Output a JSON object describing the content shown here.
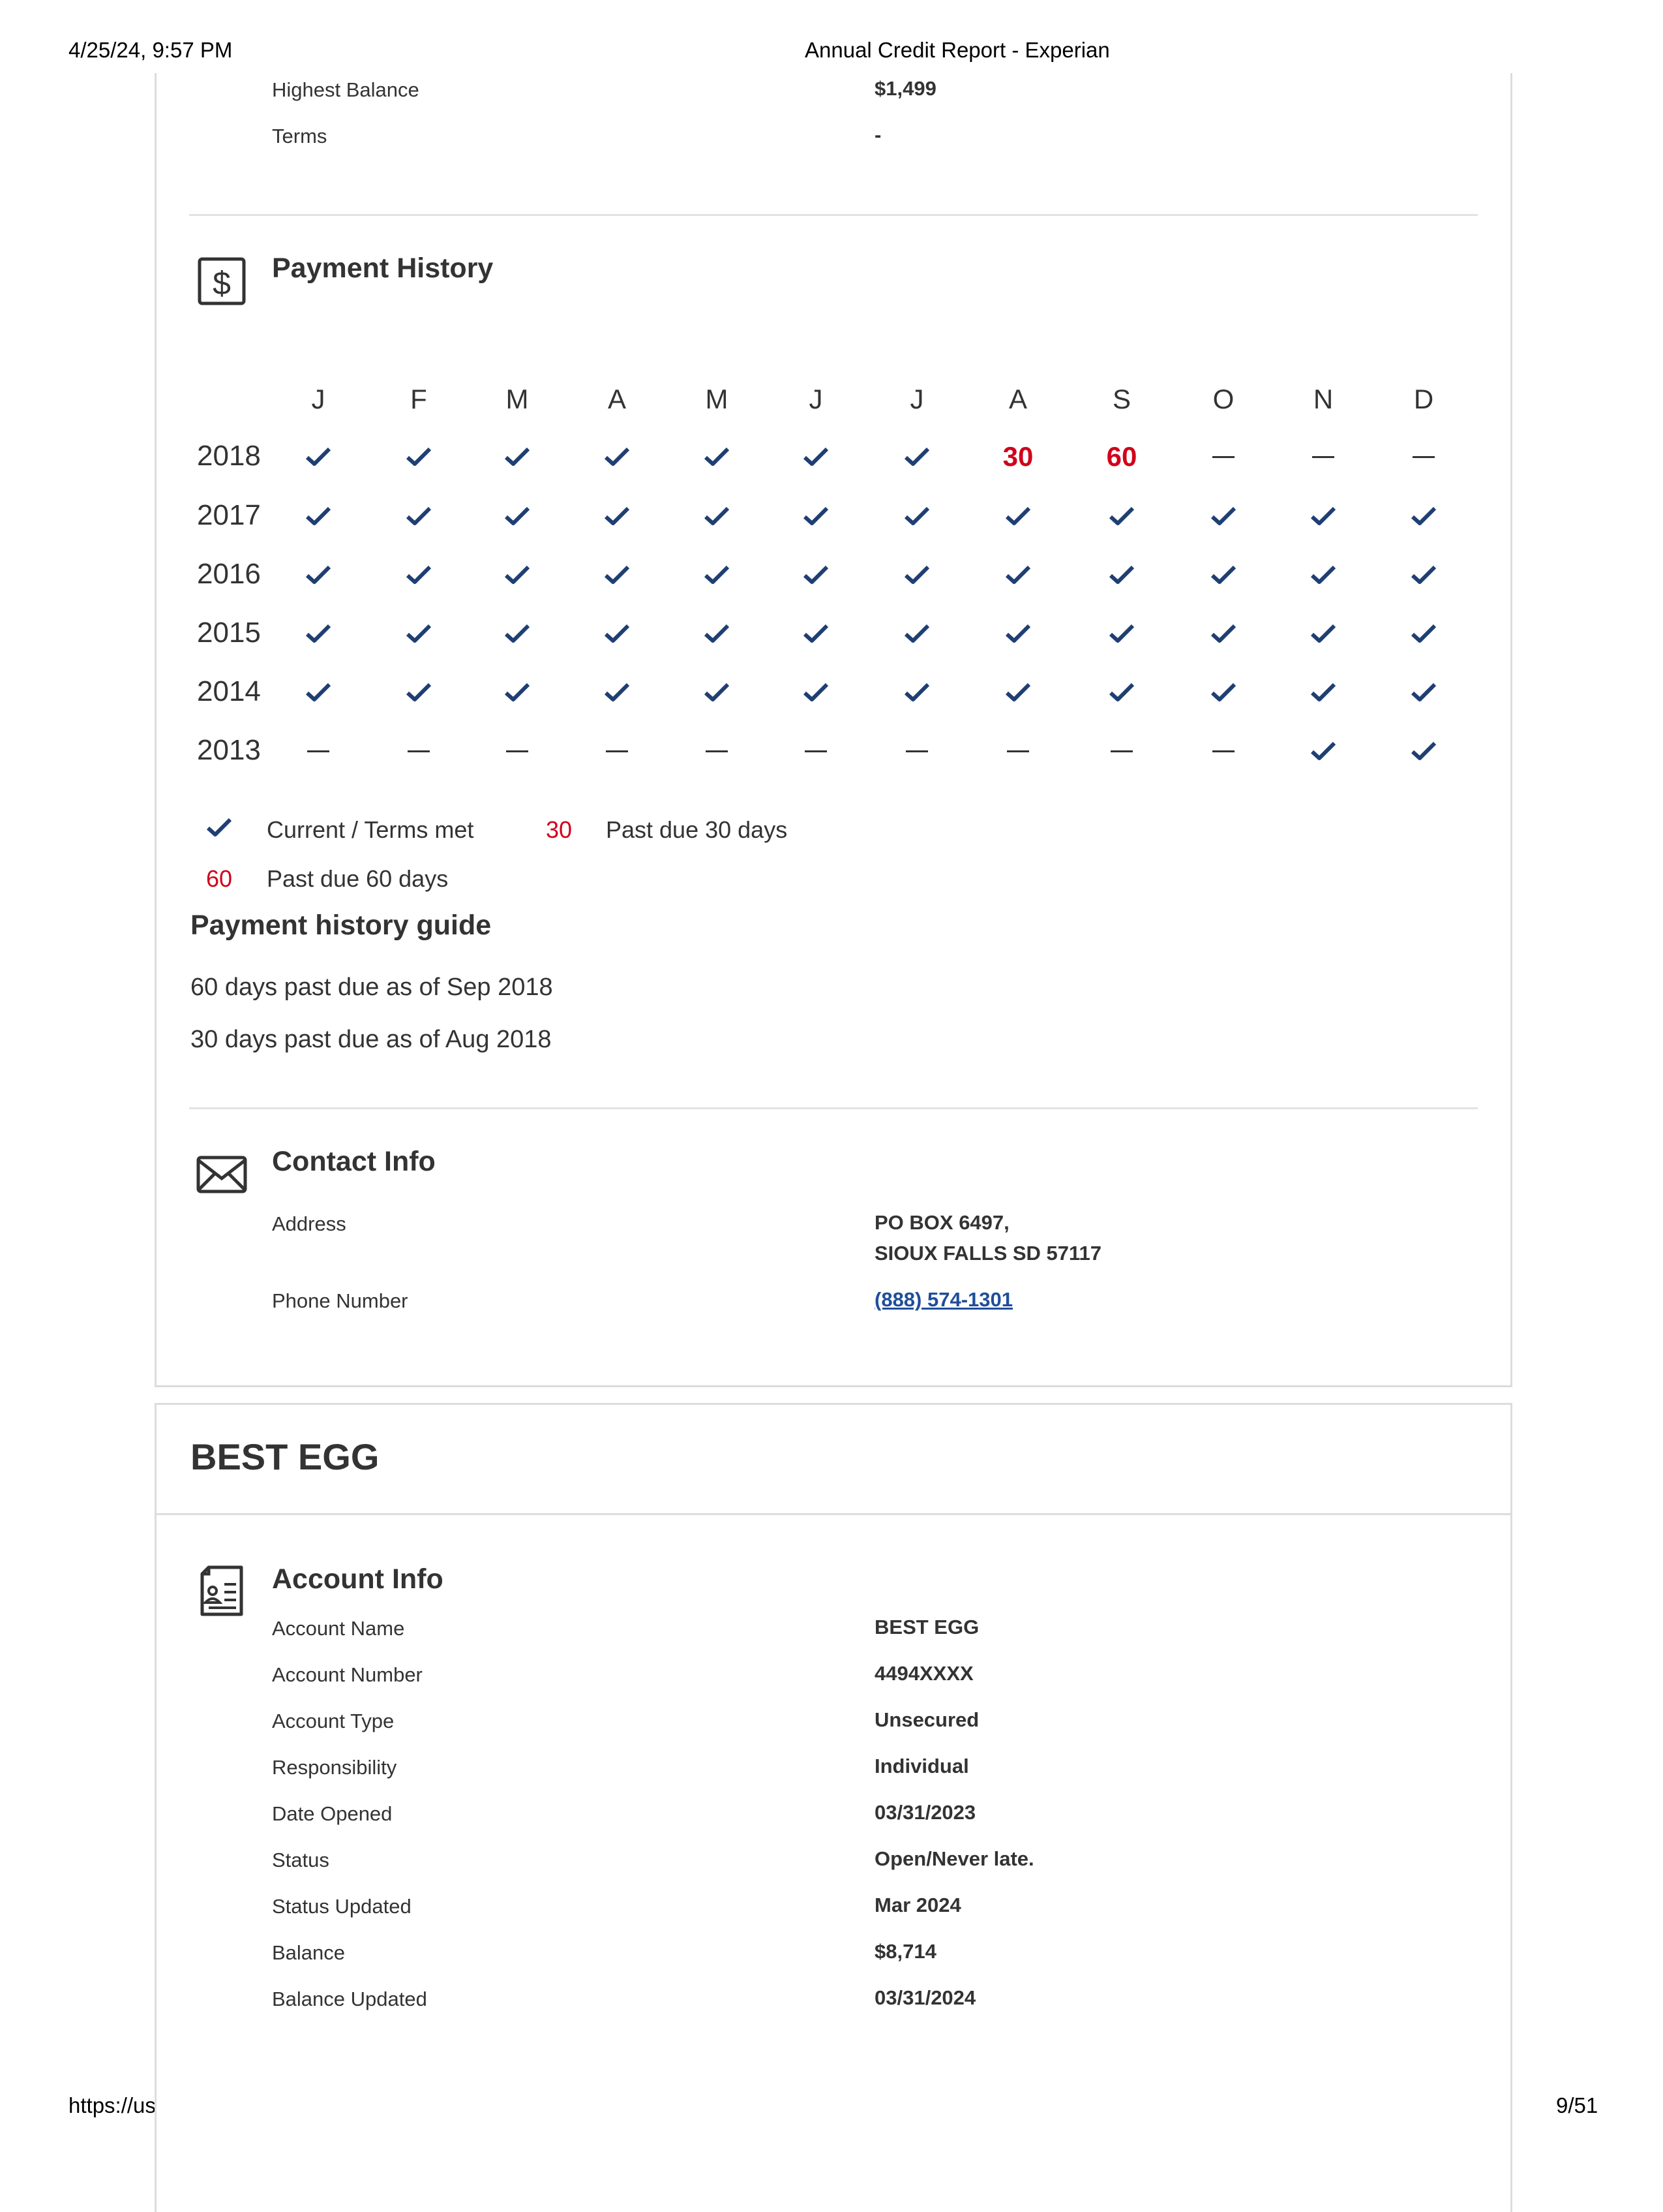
{
  "print_header": {
    "date": "4/25/24, 9:57 PM",
    "title": "Annual Credit Report - Experian"
  },
  "print_footer": {
    "url": "https://usa.experian.com/acr/printReport?type=CDI",
    "page": "9/51"
  },
  "top_fields": [
    {
      "label": "Highest Balance",
      "value": "$1,499"
    },
    {
      "label": "Terms",
      "value": "-"
    }
  ],
  "payment_history": {
    "title": "Payment History",
    "icon": "dollar-icon",
    "months": [
      "J",
      "F",
      "M",
      "A",
      "M",
      "J",
      "J",
      "A",
      "S",
      "O",
      "N",
      "D"
    ],
    "rows": [
      {
        "year": "2018",
        "cells": [
          "ok",
          "ok",
          "ok",
          "ok",
          "ok",
          "ok",
          "ok",
          "30",
          "60",
          "-",
          "-",
          "-"
        ]
      },
      {
        "year": "2017",
        "cells": [
          "ok",
          "ok",
          "ok",
          "ok",
          "ok",
          "ok",
          "ok",
          "ok",
          "ok",
          "ok",
          "ok",
          "ok"
        ]
      },
      {
        "year": "2016",
        "cells": [
          "ok",
          "ok",
          "ok",
          "ok",
          "ok",
          "ok",
          "ok",
          "ok",
          "ok",
          "ok",
          "ok",
          "ok"
        ]
      },
      {
        "year": "2015",
        "cells": [
          "ok",
          "ok",
          "ok",
          "ok",
          "ok",
          "ok",
          "ok",
          "ok",
          "ok",
          "ok",
          "ok",
          "ok"
        ]
      },
      {
        "year": "2014",
        "cells": [
          "ok",
          "ok",
          "ok",
          "ok",
          "ok",
          "ok",
          "ok",
          "ok",
          "ok",
          "ok",
          "ok",
          "ok"
        ]
      },
      {
        "year": "2013",
        "cells": [
          "-",
          "-",
          "-",
          "-",
          "-",
          "-",
          "-",
          "-",
          "-",
          "-",
          "ok",
          "ok"
        ]
      }
    ],
    "legend": {
      "current": "Current / Terms met",
      "past30_code": "30",
      "past30": "Past due 30 days",
      "past60_code": "60",
      "past60": "Past due 60 days"
    },
    "guide_title": "Payment history guide",
    "guide_lines": [
      "60 days past due as of Sep 2018",
      "30 days past due as of Aug 2018"
    ],
    "colors": {
      "check": "#1f3f73",
      "late": "#d0021b"
    }
  },
  "contact_info": {
    "title": "Contact Info",
    "icon": "envelope-icon",
    "address_label": "Address",
    "address_line1": "PO BOX 6497,",
    "address_line2": "SIOUX FALLS SD 57117",
    "phone_label": "Phone Number",
    "phone": "(888) 574-1301"
  },
  "best_egg": {
    "company": "BEST EGG",
    "account_info_title": "Account Info",
    "icon": "document-icon",
    "fields": [
      {
        "label": "Account Name",
        "value": "BEST EGG"
      },
      {
        "label": "Account Number",
        "value": "4494XXXX"
      },
      {
        "label": "Account Type",
        "value": "Unsecured"
      },
      {
        "label": "Responsibility",
        "value": "Individual"
      },
      {
        "label": "Date Opened",
        "value": "03/31/2023"
      },
      {
        "label": "Status",
        "value": "Open/Never late."
      },
      {
        "label": "Status Updated",
        "value": "Mar 2024"
      },
      {
        "label": "Balance",
        "value": "$8,714"
      },
      {
        "label": "Balance Updated",
        "value": "03/31/2024"
      }
    ]
  }
}
